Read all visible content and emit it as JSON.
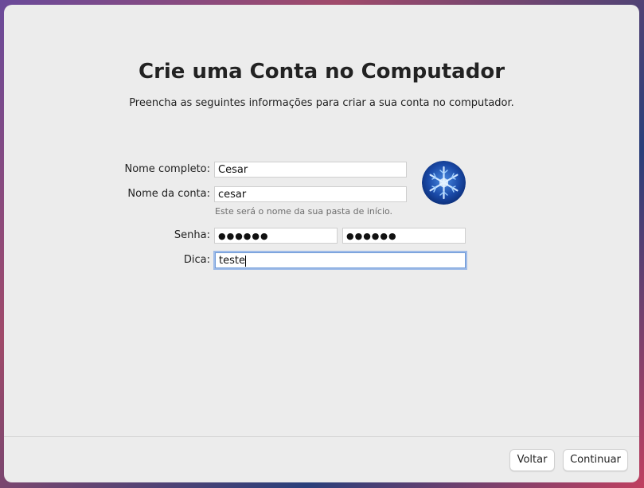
{
  "header": {
    "title": "Crie uma Conta no Computador",
    "subtitle": "Preencha as seguintes informações para criar a sua conta no computador."
  },
  "form": {
    "full_name_label": "Nome completo:",
    "full_name_value": "Cesar",
    "account_name_label": "Nome da conta:",
    "account_name_value": "cesar",
    "account_hint": "Este será o nome da sua pasta de início.",
    "password_label": "Senha:",
    "password_value": "●●●●●●",
    "password_verify_value": "●●●●●●",
    "hint_label": "Dica:",
    "hint_value": "teste"
  },
  "avatar": {
    "icon": "snowflake-avatar-icon"
  },
  "footer": {
    "back_label": "Voltar",
    "continue_label": "Continuar"
  }
}
